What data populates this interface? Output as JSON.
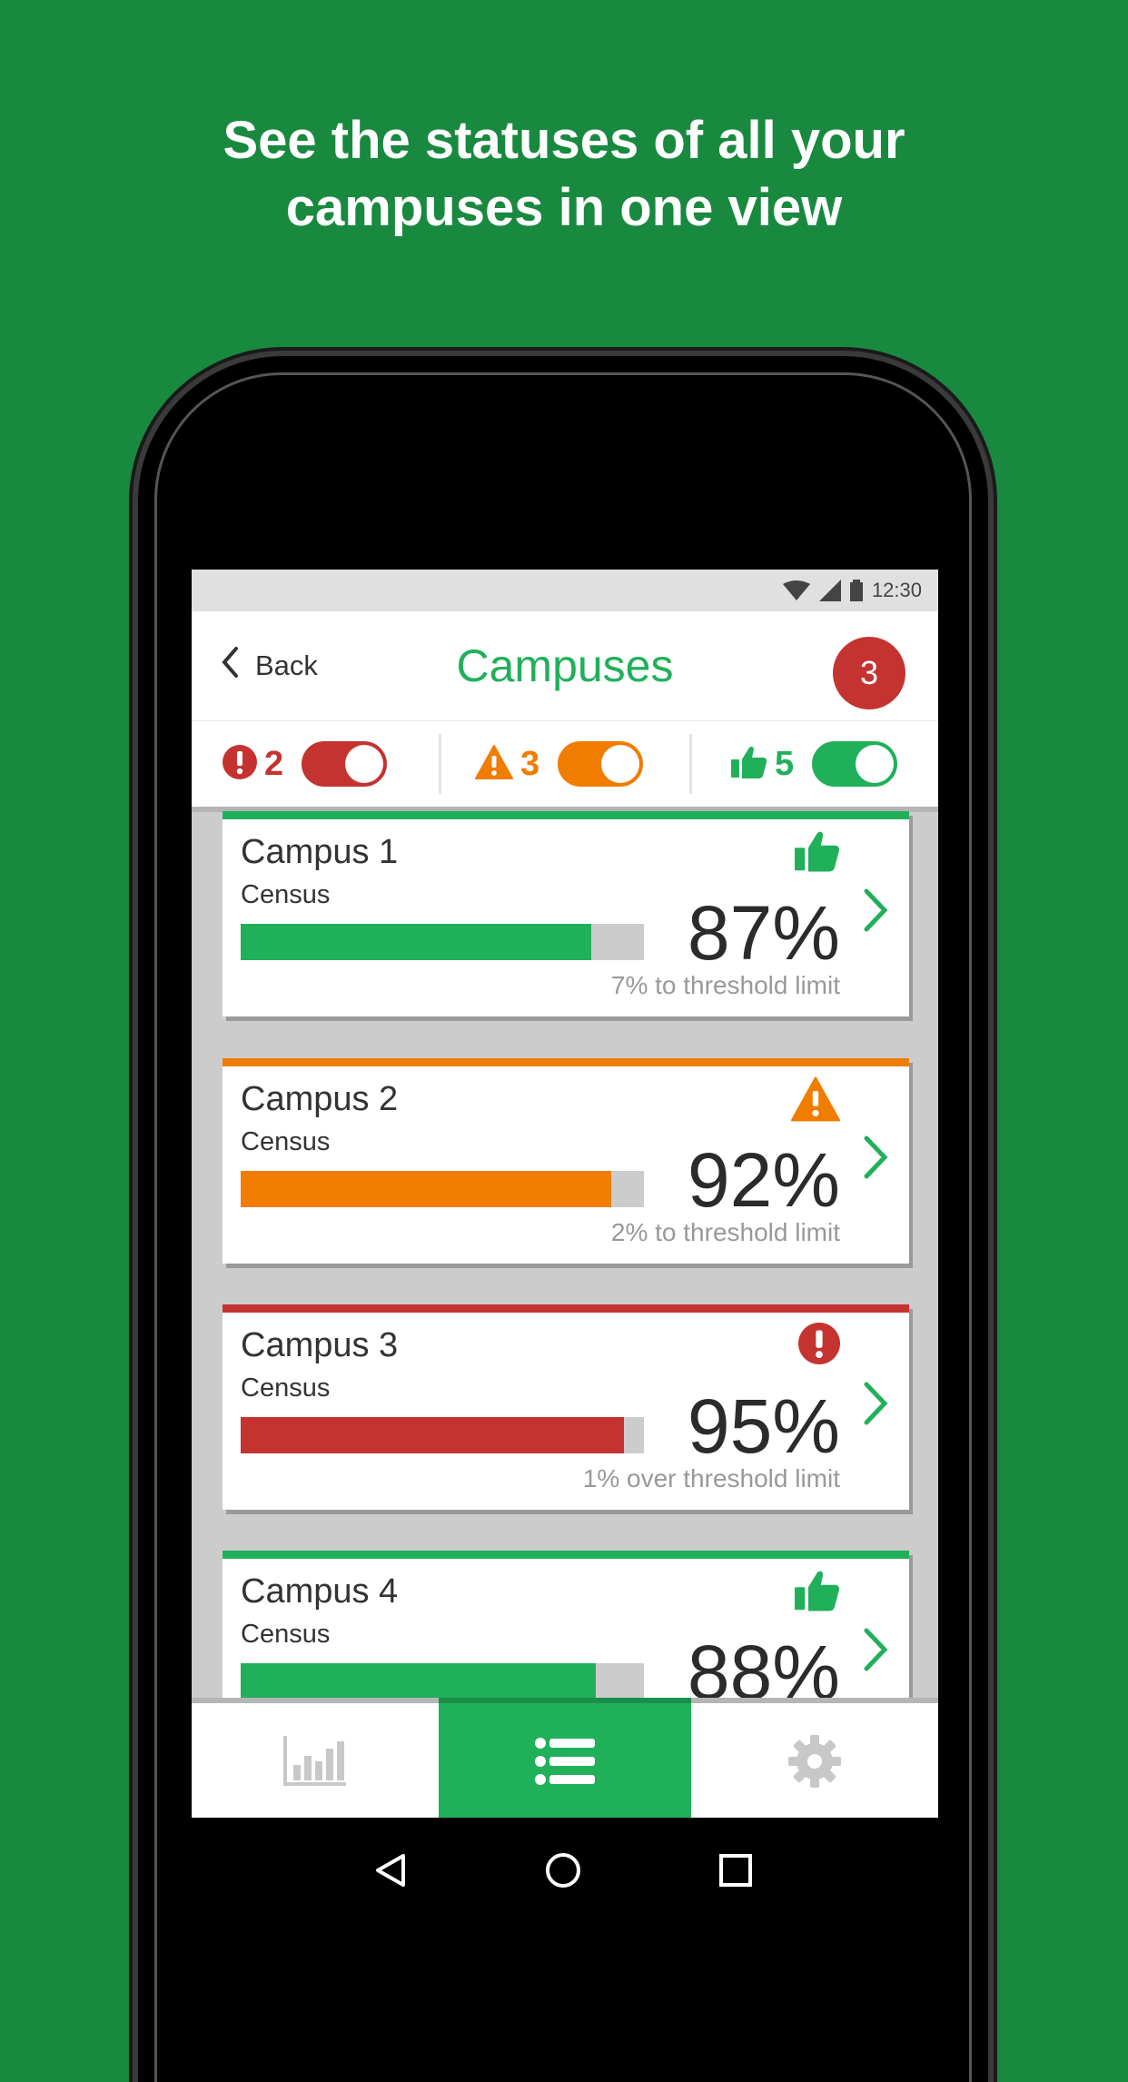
{
  "headline": {
    "line1": "See the statuses of all your",
    "line2": "campuses in one view"
  },
  "status_bar": {
    "time": "12:30"
  },
  "app_bar": {
    "back_label": "Back",
    "title": "Campuses",
    "notification_count": "3"
  },
  "filters": [
    {
      "status": "alert",
      "count": "2",
      "color": "#c43330",
      "enabled": true
    },
    {
      "status": "warning",
      "count": "3",
      "color": "#f07c00",
      "enabled": true
    },
    {
      "status": "ok",
      "count": "5",
      "color": "#21b05a",
      "enabled": true
    }
  ],
  "campuses": [
    {
      "name": "Campus 1",
      "metric": "Census",
      "percent": "87%",
      "fill": 0.87,
      "note": "7% to threshold limit",
      "status": "ok",
      "color": "#21b05a"
    },
    {
      "name": "Campus 2",
      "metric": "Census",
      "percent": "92%",
      "fill": 0.92,
      "note": "2% to threshold limit",
      "status": "warning",
      "color": "#f07c00"
    },
    {
      "name": "Campus 3",
      "metric": "Census",
      "percent": "95%",
      "fill": 0.95,
      "note": "1% over threshold limit",
      "status": "alert",
      "color": "#c43330"
    },
    {
      "name": "Campus 4",
      "metric": "Census",
      "percent": "88%",
      "fill": 0.88,
      "note": "",
      "status": "ok",
      "color": "#21b05a"
    }
  ],
  "bottom_nav": [
    {
      "icon": "bar-chart-icon",
      "active": false
    },
    {
      "icon": "list-icon",
      "active": true
    },
    {
      "icon": "gear-icon",
      "active": false
    }
  ],
  "colors": {
    "background": "#18893f",
    "accent": "#21b05a",
    "warning": "#f07c00",
    "alert": "#c43330"
  }
}
